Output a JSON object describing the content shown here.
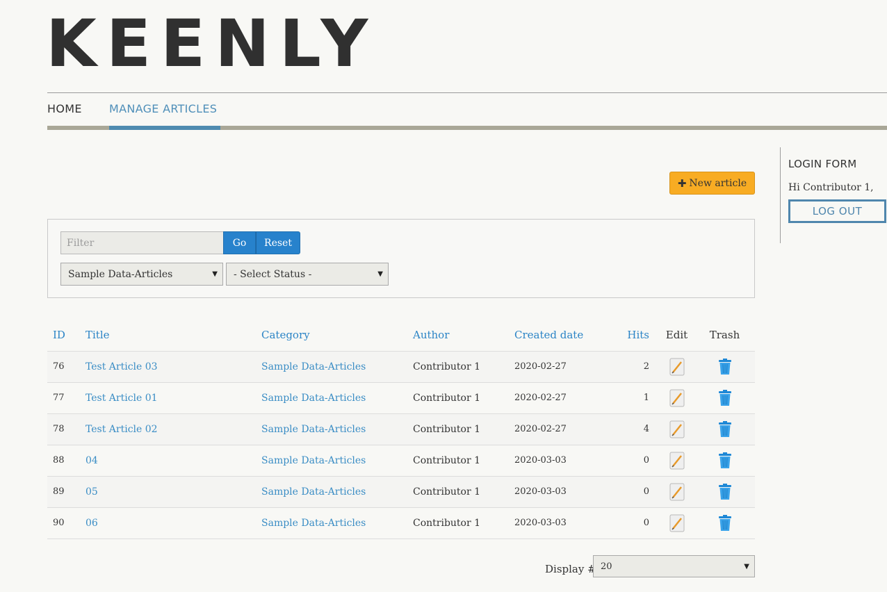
{
  "site": {
    "logo": "KEENLY"
  },
  "nav": {
    "items": [
      {
        "label": "HOME"
      },
      {
        "label": "MANAGE ARTICLES"
      }
    ]
  },
  "toolbar": {
    "new_article_label": "New article"
  },
  "filters": {
    "search_placeholder": "Filter",
    "go_label": "Go",
    "reset_label": "Reset",
    "category_selected": "Sample Data-Articles",
    "status_selected": "- Select Status -"
  },
  "table": {
    "headers": {
      "id": "ID",
      "title": "Title",
      "category": "Category",
      "author": "Author",
      "created": "Created date",
      "hits": "Hits",
      "edit": "Edit",
      "trash": "Trash"
    },
    "rows": [
      {
        "id": "76",
        "title": "Test Article 03",
        "category": "Sample Data-Articles",
        "author": "Contributor 1",
        "created": "2020-02-27",
        "hits": "2"
      },
      {
        "id": "77",
        "title": "Test Article 01",
        "category": "Sample Data-Articles",
        "author": "Contributor 1",
        "created": "2020-02-27",
        "hits": "1"
      },
      {
        "id": "78",
        "title": "Test Article 02",
        "category": "Sample Data-Articles",
        "author": "Contributor 1",
        "created": "2020-02-27",
        "hits": "4"
      },
      {
        "id": "88",
        "title": "04",
        "category": "Sample Data-Articles",
        "author": "Contributor 1",
        "created": "2020-03-03",
        "hits": "0"
      },
      {
        "id": "89",
        "title": "05",
        "category": "Sample Data-Articles",
        "author": "Contributor 1",
        "created": "2020-03-03",
        "hits": "0"
      },
      {
        "id": "90",
        "title": "06",
        "category": "Sample Data-Articles",
        "author": "Contributor 1",
        "created": "2020-03-03",
        "hits": "0"
      }
    ]
  },
  "pagination": {
    "display_label": "Display #",
    "display_value": "20"
  },
  "sidebar": {
    "login_title": "LOGIN FORM",
    "greeting": "Hi Contributor 1,",
    "logout_label": "LOG OUT"
  },
  "colors": {
    "accent_blue": "#2782cc",
    "link_blue": "#3a8dc5",
    "new_article_orange": "#f8ac23",
    "nav_bar": "#a9a797",
    "nav_active": "#4f8bb0"
  },
  "icons": {
    "new_article": "plus-icon",
    "edit": "pencil-edit-icon",
    "trash": "trash-can-icon",
    "dropdown": "triangle-down-icon"
  }
}
